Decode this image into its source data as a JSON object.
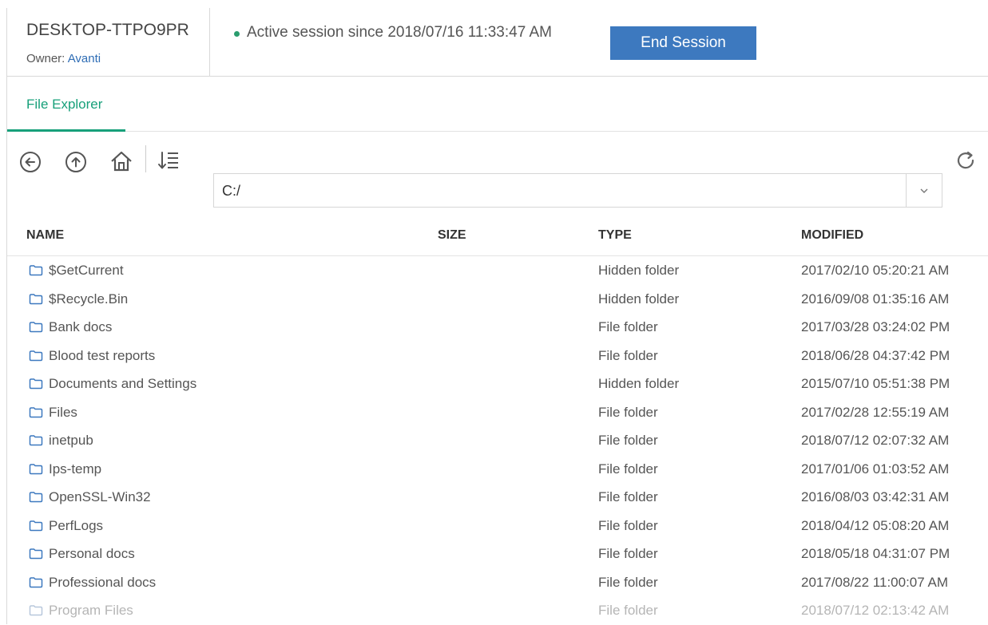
{
  "header": {
    "device_name": "DESKTOP-TTPO9PR",
    "owner_label": "Owner:",
    "owner_name": "Avanti",
    "session_status": "Active session since 2018/07/16 11:33:47 AM",
    "end_session_label": "End Session",
    "status_color": "#2a9d6e",
    "accent_color": "#3d79bf"
  },
  "tabs": [
    {
      "label": "File Explorer",
      "active": true
    }
  ],
  "toolbar": {
    "icons": [
      "back-icon",
      "up-icon",
      "home-icon",
      "sort-icon",
      "refresh-icon"
    ],
    "path_value": "C:/"
  },
  "table": {
    "columns": [
      "NAME",
      "SIZE",
      "TYPE",
      "MODIFIED"
    ],
    "rows": [
      {
        "name": "$GetCurrent",
        "size": "",
        "type": "Hidden folder",
        "modified": "2017/02/10 05:20:21 AM"
      },
      {
        "name": "$Recycle.Bin",
        "size": "",
        "type": "Hidden folder",
        "modified": "2016/09/08 01:35:16 AM"
      },
      {
        "name": "Bank docs",
        "size": "",
        "type": "File folder",
        "modified": "2017/03/28 03:24:02 PM"
      },
      {
        "name": "Blood test reports",
        "size": "",
        "type": "File folder",
        "modified": "2018/06/28 04:37:42 PM"
      },
      {
        "name": "Documents and Settings",
        "size": "",
        "type": "Hidden folder",
        "modified": "2015/07/10 05:51:38 PM"
      },
      {
        "name": "Files",
        "size": "",
        "type": "File folder",
        "modified": "2017/02/28 12:55:19 AM"
      },
      {
        "name": "inetpub",
        "size": "",
        "type": "File folder",
        "modified": "2018/07/12 02:07:32 AM"
      },
      {
        "name": "Ips-temp",
        "size": "",
        "type": "File folder",
        "modified": "2017/01/06 01:03:52 AM"
      },
      {
        "name": "OpenSSL-Win32",
        "size": "",
        "type": "File folder",
        "modified": "2016/08/03 03:42:31 AM"
      },
      {
        "name": "PerfLogs",
        "size": "",
        "type": "File folder",
        "modified": "2018/04/12 05:08:20 AM"
      },
      {
        "name": "Personal docs",
        "size": "",
        "type": "File folder",
        "modified": "2018/05/18 04:31:07 PM"
      },
      {
        "name": "Professional docs",
        "size": "",
        "type": "File folder",
        "modified": "2017/08/22 11:00:07 AM"
      },
      {
        "name": "Program Files",
        "size": "",
        "type": "File folder",
        "modified": "2018/07/12 02:13:42 AM"
      }
    ]
  },
  "colors": {
    "tab_active": "#17a07a",
    "folder_icon": "#3d79bf"
  }
}
